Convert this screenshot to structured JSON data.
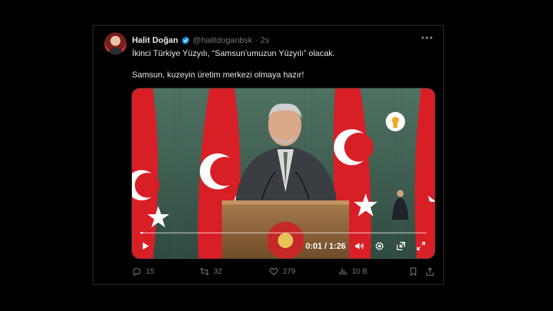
{
  "tweet": {
    "author_name": "Halit Doğan",
    "handle": "@halitdoganbsk",
    "separator": "·",
    "time": "2s",
    "more_label": "•••",
    "line1": "İkinci Türkiye Yüzyılı, “Samsun’umuzun Yüzyılı” olacak.",
    "line2": "Samsun, kuzeyin üretim merkezi olmaya hazır!"
  },
  "video": {
    "timecode": "0:01 / 1:26",
    "progress": 0.01
  },
  "actions": {
    "replies": "15",
    "retweets": "32",
    "likes": "279",
    "views": "10 B"
  },
  "colors": {
    "verified": "#1d9bf0",
    "flag_red": "#d81f26",
    "backdrop": "#4a6d5e"
  },
  "icons": [
    "verified-badge-icon",
    "more-icon",
    "play-icon",
    "volume-icon",
    "settings-icon",
    "pip-icon",
    "fullscreen-icon",
    "reply-icon",
    "retweet-icon",
    "like-icon",
    "views-icon",
    "bookmark-icon",
    "share-icon"
  ]
}
